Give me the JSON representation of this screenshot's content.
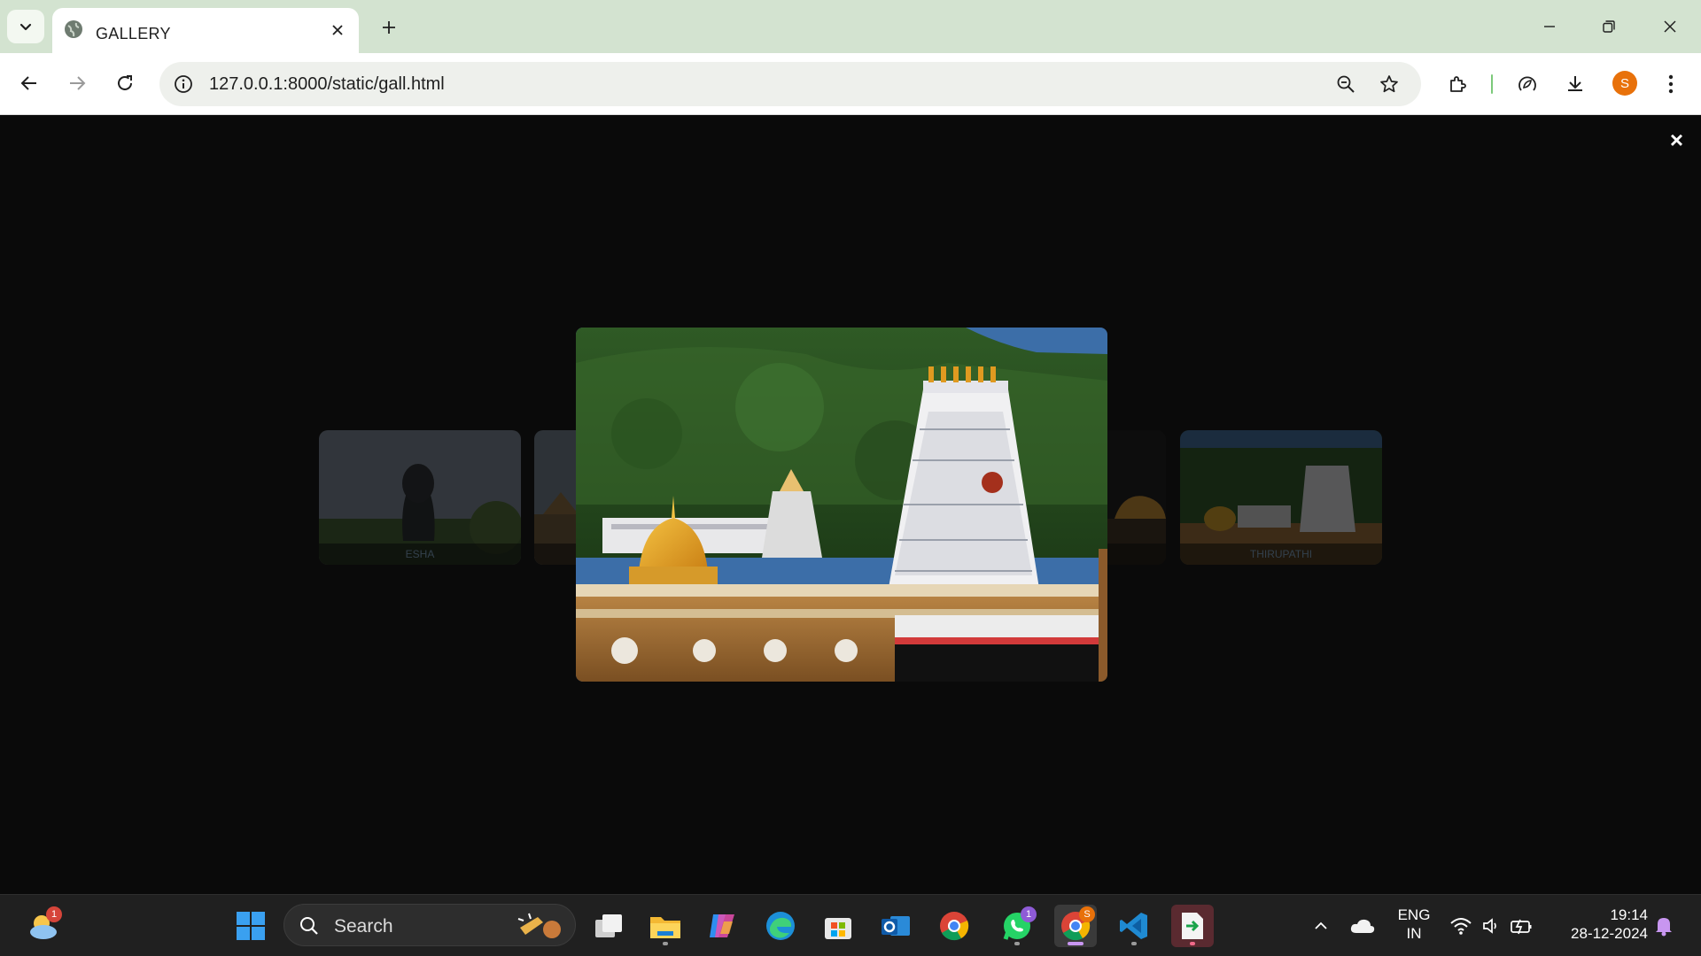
{
  "browser": {
    "tab_title": "GALLERY",
    "url": "127.0.0.1:8000/static/gall.html",
    "profile_initial": "S"
  },
  "gallery": {
    "close_symbol": "×",
    "cards": [
      {
        "caption": "ESHA"
      },
      {
        "caption": ""
      },
      {
        "caption": ""
      },
      {
        "caption": "THIRUPATHI"
      }
    ],
    "featured_image": "Tirupati temple"
  },
  "taskbar": {
    "search_placeholder": "Search",
    "weather_badge": "1",
    "whatsapp_badge": "1",
    "chrome_badge": "S",
    "lang_line1": "ENG",
    "lang_line2": "IN",
    "time": "19:14",
    "date": "28-12-2024"
  },
  "colors": {
    "tabbar": "#d3e3d0",
    "accent_orange": "#e8710a",
    "page_bg": "#0a0a0a",
    "taskbar_bg": "#202020"
  }
}
